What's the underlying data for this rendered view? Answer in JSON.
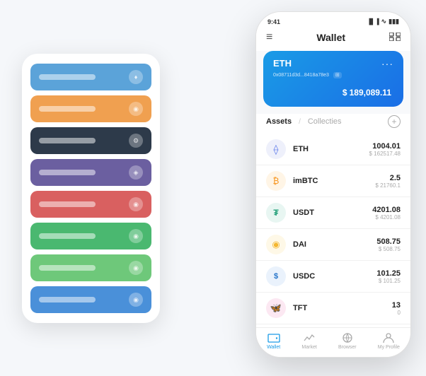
{
  "scene": {
    "background": "#f5f7fa"
  },
  "cardStack": {
    "cards": [
      {
        "id": "blue-card",
        "color": "#5ba3d9",
        "icon": "♦"
      },
      {
        "id": "orange-card",
        "color": "#f0a050",
        "icon": "◉"
      },
      {
        "id": "dark-card",
        "color": "#2d3a4a",
        "icon": "⚙"
      },
      {
        "id": "purple-card",
        "color": "#6b5fa0",
        "icon": "◈"
      },
      {
        "id": "red-card",
        "color": "#d96060",
        "icon": "◉"
      },
      {
        "id": "green-card",
        "color": "#4ab870",
        "icon": "◉"
      },
      {
        "id": "lightgreen-card",
        "color": "#6ec87a",
        "icon": "◉"
      },
      {
        "id": "blue2-card",
        "color": "#4a90d9",
        "icon": "◉"
      }
    ]
  },
  "phone": {
    "statusBar": {
      "time": "9:41",
      "signal": "▐▐▐",
      "wifi": "▲",
      "battery": "▮▮▮"
    },
    "header": {
      "menuIcon": "≡",
      "title": "Wallet",
      "expandIcon": "⊡"
    },
    "ethCard": {
      "title": "ETH",
      "address": "0x08711d3d...8418a78e3",
      "balanceSymbol": "$",
      "balance": "189,089.11",
      "dotsIcon": "..."
    },
    "assetsTabs": {
      "active": "Assets",
      "divider": "/",
      "inactive": "Collecties",
      "addIcon": "+"
    },
    "assets": [
      {
        "name": "ETH",
        "iconColor": "#627eea",
        "iconSymbol": "⟠",
        "amount": "1004.01",
        "usd": "$ 162517.48"
      },
      {
        "name": "imBTC",
        "iconColor": "#f7931a",
        "iconSymbol": "₿",
        "amount": "2.5",
        "usd": "$ 21760.1"
      },
      {
        "name": "USDT",
        "iconColor": "#26a17b",
        "iconSymbol": "₮",
        "amount": "4201.08",
        "usd": "$ 4201.08"
      },
      {
        "name": "DAI",
        "iconColor": "#f4b731",
        "iconSymbol": "◈",
        "amount": "508.75",
        "usd": "$ 508.75"
      },
      {
        "name": "USDC",
        "iconColor": "#2775ca",
        "iconSymbol": "$",
        "amount": "101.25",
        "usd": "$ 101.25"
      },
      {
        "name": "TFT",
        "iconColor": "#e83e8c",
        "iconSymbol": "🦋",
        "amount": "13",
        "usd": "0"
      }
    ],
    "bottomNav": [
      {
        "id": "wallet",
        "label": "Wallet",
        "icon": "◎",
        "active": true
      },
      {
        "id": "market",
        "label": "Market",
        "icon": "📈",
        "active": false
      },
      {
        "id": "browser",
        "label": "Browser",
        "icon": "⊙",
        "active": false
      },
      {
        "id": "profile",
        "label": "My Profile",
        "icon": "👤",
        "active": false
      }
    ]
  }
}
